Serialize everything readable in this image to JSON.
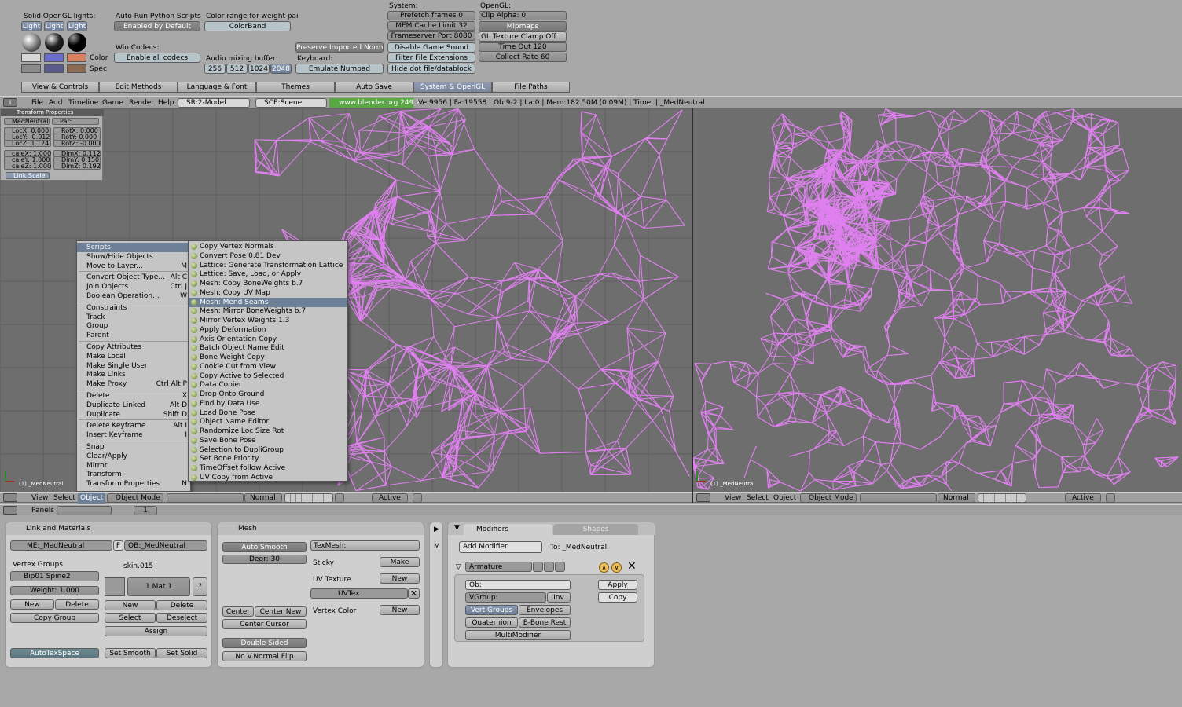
{
  "user_prefs": {
    "solid_lights_title": "Solid OpenGL lights:",
    "light_buttons": [
      "Light",
      "Light",
      "Light"
    ],
    "color_label": "Color",
    "spec_label": "Spec",
    "auto_run_title": "Auto Run Python Scripts",
    "auto_run_btn": "Enabled by Default",
    "color_range_title": "Color range for weight pai",
    "color_band_btn": "ColorBand",
    "win_codecs_title": "Win Codecs:",
    "win_codecs_btn": "Enable all codecs",
    "audio_title": "Audio mixing buffer:",
    "audio_opts": [
      "256",
      "512",
      "1024",
      "2048"
    ],
    "preserve_btn": "Preserve Imported Normal",
    "keyboard_title": "Keyboard:",
    "emulate_btn": "Emulate Numpad",
    "system_title": "System:",
    "prefetch": "Prefetch frames 0",
    "mem_cache": "MEM Cache Limit 32",
    "frameserver": "Frameserver Port 8080",
    "disable_sound": "Disable Game Sound",
    "filter_ext": "Filter File Extensions",
    "hide_dot": "Hide dot file/datablock",
    "opengl_title": "OpenGL:",
    "clip_alpha": "Clip Alpha: 0",
    "mipmaps": "Mipmaps",
    "gl_clamp": "GL Texture Clamp Off",
    "timeout": "Time Out 120",
    "collect_rate": "Collect Rate 60",
    "tabs": [
      "View & Controls",
      "Edit Methods",
      "Language & Font",
      "Themes",
      "Auto Save",
      "System & OpenGL",
      "File Paths"
    ]
  },
  "info_header": {
    "menus": [
      "File",
      "Add",
      "Timeline",
      "Game",
      "Render",
      "Help"
    ],
    "screen": "SR:2-Model",
    "scene": "SCE:Scene",
    "url": "www.blender.org 249.2",
    "stats": "Ve:9956 | Fa:19558 | Ob:9-2 | La:0 | Mem:182.50M (0.09M) | Time: | _MedNeutral"
  },
  "transform_props": {
    "title": "Transform Properties",
    "name": "MedNeutral",
    "par": "Par:",
    "locx": "LocX: 0.000",
    "locy": "LocY: -0.012",
    "locz": "LocZ: 1.124",
    "rotx": "RotX: 0.000",
    "roty": "RotY: 0.000",
    "rotz": "RotZ: -0.000",
    "scalex": "caleX: 1.000",
    "scaley": "caleY: 1.000",
    "scalez": "caleZ: 1.000",
    "dimx": "DimX: 0.112",
    "dimy": "DimY: 0.150",
    "dimz": "DimZ: 0.192",
    "link_scale": "Link Scale"
  },
  "viewport_label": "(1) _MedNeutral",
  "object_menu": [
    {
      "label": "Scripts",
      "sc": ""
    },
    {
      "label": "Show/Hide Objects",
      "sc": ""
    },
    {
      "label": "Move to Layer...",
      "sc": "M"
    },
    {
      "label": "Convert Object Type...",
      "sc": "Alt C"
    },
    {
      "label": "Join Objects",
      "sc": "Ctrl J"
    },
    {
      "label": "Boolean Operation...",
      "sc": "W"
    },
    {
      "label": "Constraints",
      "sc": ""
    },
    {
      "label": "Track",
      "sc": ""
    },
    {
      "label": "Group",
      "sc": ""
    },
    {
      "label": "Parent",
      "sc": ""
    },
    {
      "label": "Copy Attributes",
      "sc": ""
    },
    {
      "label": "Make Local",
      "sc": ""
    },
    {
      "label": "Make Single User",
      "sc": ""
    },
    {
      "label": "Make Links",
      "sc": ""
    },
    {
      "label": "Make Proxy",
      "sc": "Ctrl Alt P"
    },
    {
      "label": "Delete",
      "sc": "X"
    },
    {
      "label": "Duplicate Linked",
      "sc": "Alt D"
    },
    {
      "label": "Duplicate",
      "sc": "Shift D"
    },
    {
      "label": "Delete Keyframe",
      "sc": "Alt I"
    },
    {
      "label": "Insert Keyframe",
      "sc": "I"
    },
    {
      "label": "Snap",
      "sc": ""
    },
    {
      "label": "Clear/Apply",
      "sc": ""
    },
    {
      "label": "Mirror",
      "sc": ""
    },
    {
      "label": "Transform",
      "sc": ""
    },
    {
      "label": "Transform Properties",
      "sc": "N"
    }
  ],
  "scripts_menu": [
    "Copy Vertex Normals",
    "Convert Pose 0.81 Dev",
    "Lattice: Generate Transformation Lattice",
    "Lattice: Save, Load, or Apply",
    "Mesh: Copy BoneWeights b.7",
    "Mesh: Copy UV Map",
    "Mesh: Mend Seams",
    "Mesh: Mirror BoneWeights b.7",
    "Mirror Vertex Weights 1.3",
    "Apply Deformation",
    "Axis Orientation Copy",
    "Batch Object Name Edit",
    "Bone Weight Copy",
    "Cookie Cut from View",
    "Copy Active to Selected",
    "Data Copier",
    "Drop Onto Ground",
    "Find by Data Use",
    "Load Bone Pose",
    "Object Name Editor",
    "Randomize Loc Size Rot",
    "Save Bone Pose",
    "Selection to DupliGroup",
    "Set Bone Priority",
    "TimeOffset follow Active",
    "UV Copy from Active"
  ],
  "view3d_header": {
    "menus": [
      "View",
      "Select",
      "Object"
    ],
    "mode": "Object Mode",
    "shade": "Normal",
    "pivot": "Active"
  },
  "buttons_header": {
    "panels": "Panels",
    "frame": "1"
  },
  "link_materials": {
    "title": "Link and Materials",
    "me": "ME:_MedNeutral",
    "f": "F",
    "ob": "OB:_MedNeutral",
    "vgroups_title": "Vertex Groups",
    "vgroup": "Bip01 Spine2",
    "weight": "Weight: 1.000",
    "new": "New",
    "delete": "Delete",
    "copy_group": "Copy Group",
    "mat_name": "skin.015",
    "mat": "1 Mat 1",
    "q": "?",
    "mat_new": "New",
    "mat_delete": "Delete",
    "select": "Select",
    "deselect": "Deselect",
    "assign": "Assign",
    "autotex": "AutoTexSpace",
    "set_smooth": "Set Smooth",
    "set_solid": "Set Solid"
  },
  "mesh_panel": {
    "title": "Mesh",
    "auto_smooth": "Auto Smooth",
    "degr": "Degr: 30",
    "texmesh": "TexMesh:",
    "sticky": "Sticky",
    "make": "Make",
    "uv_tex": "UV Texture",
    "uv_new": "New",
    "uvtex_name": "UVTex",
    "vcol": "Vertex Color",
    "vcol_new": "New",
    "center": "Center",
    "center_new": "Center New",
    "center_cursor": "Center Cursor",
    "double_sided": "Double Sided",
    "no_vnormal": "No V.Normal Flip"
  },
  "side_m": "M",
  "modifiers": {
    "tab1": "Modifiers",
    "tab2": "Shapes",
    "add": "Add Modifier",
    "to": "To: _MedNeutral",
    "armature": "Armature",
    "ob": "Ob:",
    "vgroup": "VGroup:",
    "inv": "Inv",
    "vertgroups": "Vert.Groups",
    "envelopes": "Envelopes",
    "quaternion": "Quaternion",
    "bbone": "B-Bone Rest",
    "multi": "MultiModifier",
    "apply": "Apply",
    "copy": "Copy"
  },
  "colors": {
    "wire": "#e080f0",
    "accent": "#6e7f98",
    "green": "#3a9a3a"
  }
}
